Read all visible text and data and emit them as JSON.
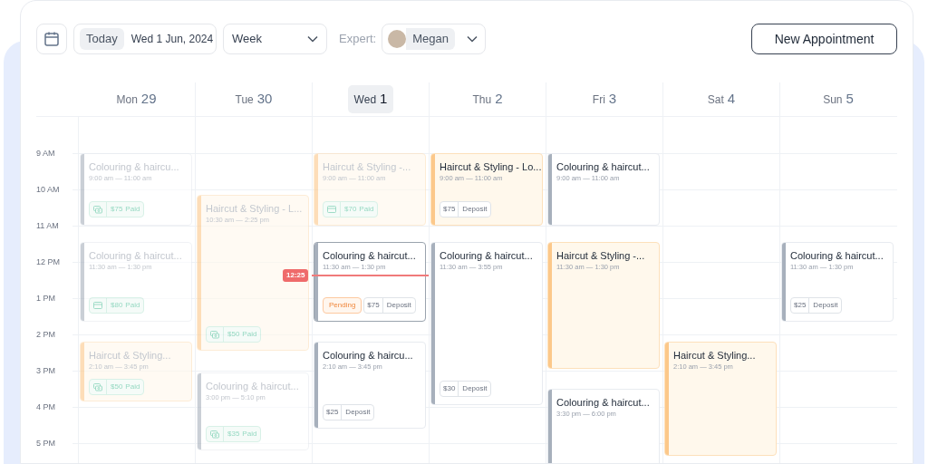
{
  "toolbar": {
    "today_button": "Today",
    "date": "Wed 1 Jun, 2024",
    "view_select": "Week",
    "expert_label": "Expert:",
    "expert": "Megan",
    "new_button": "New Appointment"
  },
  "days": [
    {
      "name": "Mon",
      "number": "29",
      "selected": false,
      "events": [
        {
          "kind": "colouring",
          "faded": true,
          "selected": false,
          "title": "Colouring & haircu...",
          "time": "9:00 am — 11:00 am",
          "payment": {
            "kind": "cash",
            "amount": "$75",
            "label": "Paid"
          }
        },
        {
          "kind": "colouring",
          "faded": true,
          "selected": false,
          "title": "Colouring & haircut...",
          "time": "11:30 am — 1:30 pm",
          "payment": {
            "kind": "card",
            "amount": "$80",
            "label": "Paid"
          }
        },
        {
          "kind": "haircut",
          "faded": true,
          "selected": false,
          "title": "Haircut & Styling...",
          "time": "2:10 am — 3:45 pm",
          "payment": {
            "kind": "cash",
            "amount": "$50",
            "label": "Paid"
          }
        }
      ]
    },
    {
      "name": "Tue",
      "number": "30",
      "selected": false,
      "events": [
        {
          "kind": "haircut",
          "faded": true,
          "selected": false,
          "title": "Haircut & Styling - L...",
          "time": "10:30 am — 2:25 pm",
          "payment": {
            "kind": "cash",
            "amount": "$50",
            "label": "Paid"
          }
        },
        {
          "kind": "colouring",
          "faded": true,
          "selected": false,
          "title": "Colouring & haircut...",
          "time": "3:00 pm — 5:10 pm",
          "payment": {
            "kind": "cash",
            "amount": "$35",
            "label": "Paid"
          }
        }
      ]
    },
    {
      "name": "Wed",
      "number": "1",
      "selected": true,
      "events": [
        {
          "kind": "haircut",
          "faded": true,
          "selected": false,
          "title": "Haircut & Styling -...",
          "time": "9:00 am — 11:00 am",
          "payment": {
            "kind": "card",
            "amount": "$70",
            "label": "Paid"
          }
        },
        {
          "kind": "colouring",
          "faded": false,
          "selected": true,
          "title": "Colouring & haircut...",
          "time": "11:30 am — 1:30 pm",
          "tag": "Pending",
          "payment": {
            "kind": "deposit",
            "amount": "$75",
            "label": "Deposit"
          }
        },
        {
          "kind": "colouring",
          "faded": false,
          "selected": false,
          "title": "Colouring & haircu...",
          "time": "2:10 am — 3:45 pm",
          "payment": {
            "kind": "deposit",
            "amount": "$25",
            "label": "Deposit"
          }
        }
      ]
    },
    {
      "name": "Thu",
      "number": "2",
      "selected": false,
      "events": [
        {
          "kind": "haircut",
          "faded": false,
          "selected": false,
          "title": "Haircut & Styling - Lo...",
          "time": "9:00 am — 11:00 am",
          "payment": {
            "kind": "deposit",
            "amount": "$75",
            "label": "Deposit"
          }
        },
        {
          "kind": "colouring",
          "faded": false,
          "selected": false,
          "title": "Colouring & haircut...",
          "time": "11:30 am — 3:55 pm",
          "payment": {
            "kind": "deposit",
            "amount": "$30",
            "label": "Deposit"
          }
        }
      ]
    },
    {
      "name": "Fri",
      "number": "3",
      "selected": false,
      "events": [
        {
          "kind": "colouring",
          "faded": false,
          "selected": false,
          "title": "Colouring & haircut...",
          "time": "9:00 am — 11:00 am"
        },
        {
          "kind": "haircut",
          "faded": false,
          "selected": false,
          "title": "Haircut & Styling -...",
          "time": "11:30 am — 1:30 pm"
        },
        {
          "kind": "colouring",
          "faded": false,
          "selected": false,
          "title": "Colouring & haircut...",
          "time": "3:30 pm — 6:00 pm"
        }
      ]
    },
    {
      "name": "Sat",
      "number": "4",
      "selected": false,
      "events": [
        {
          "kind": "haircut",
          "faded": false,
          "selected": false,
          "title": "Haircut & Styling...",
          "time": "2:10 am — 3:45 pm"
        }
      ]
    },
    {
      "name": "Sun",
      "number": "5",
      "selected": false,
      "events": [
        {
          "kind": "colouring",
          "faded": false,
          "selected": false,
          "title": "Colouring & haircut...",
          "time": "11:30 am — 1:30 pm",
          "payment": {
            "kind": "deposit",
            "amount": "$25",
            "label": "Deposit"
          }
        }
      ]
    }
  ],
  "hours": [
    "9 AM",
    "10 AM",
    "11 AM",
    "12 PM",
    "1 PM",
    "2 PM",
    "3 PM",
    "4 PM",
    "5 PM"
  ],
  "now": {
    "label": "12:25"
  }
}
